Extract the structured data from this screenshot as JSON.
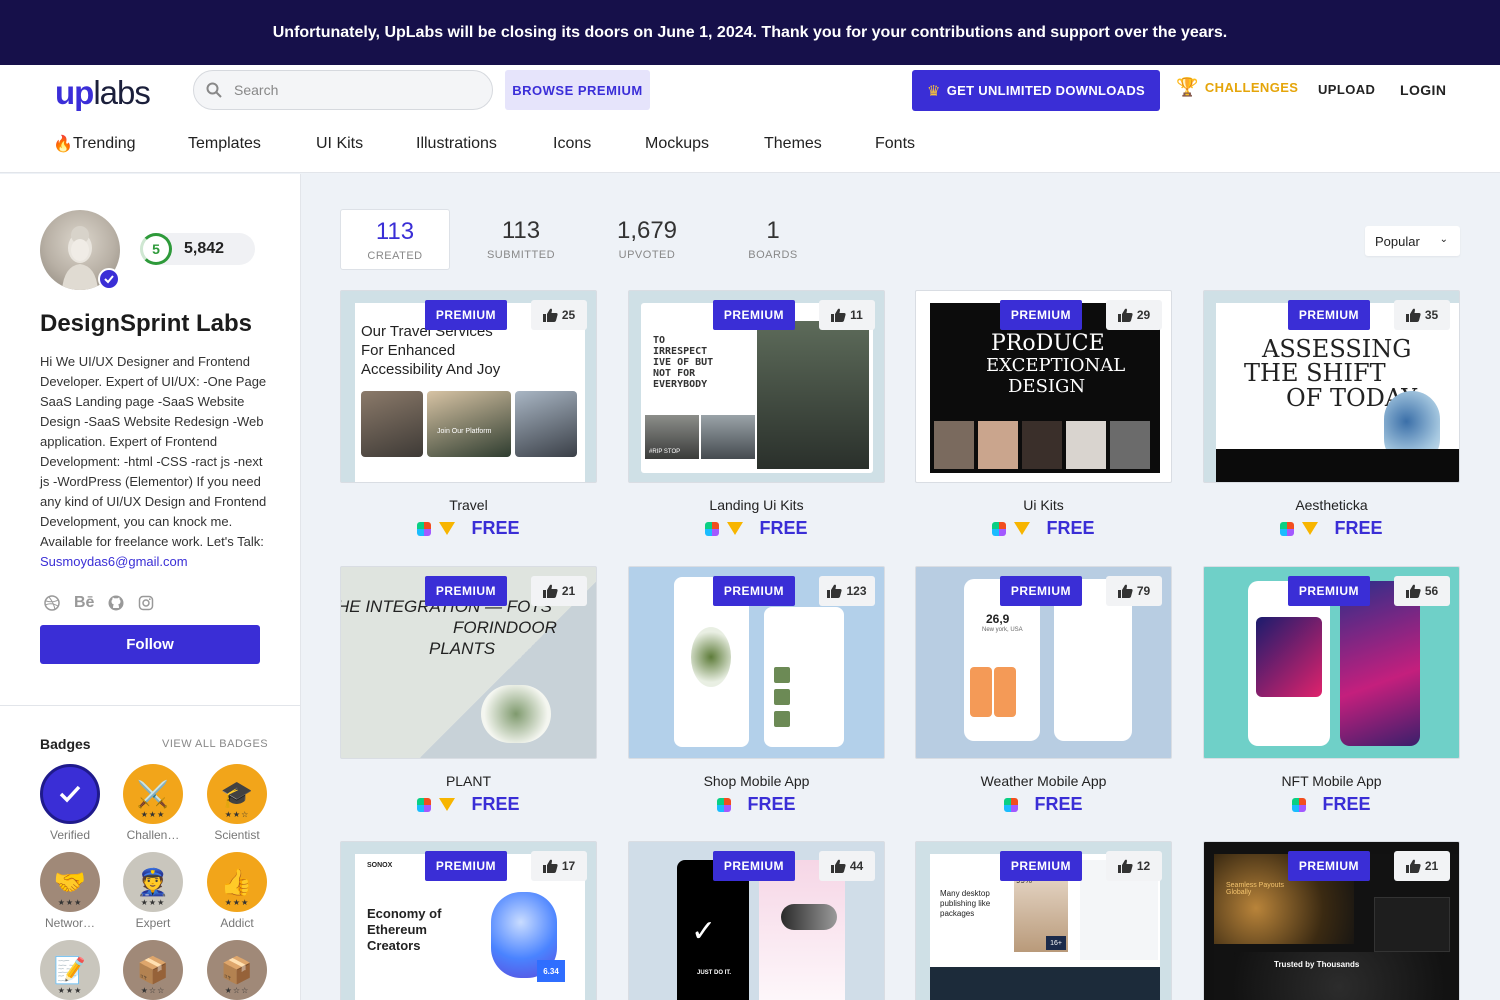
{
  "banner": {
    "text": "Unfortunately, UpLabs will be closing its doors on June 1, 2024. Thank you for your contributions and support over the years."
  },
  "header": {
    "logo_up": "up",
    "logo_labs": "labs",
    "search_placeholder": "Search",
    "browse_premium": "BROWSE PREMIUM",
    "get_unlimited": "GET UNLIMITED DOWNLOADS",
    "challenges": "CHALLENGES",
    "upload": "UPLOAD",
    "login": "LOGIN"
  },
  "nav": [
    "Trending",
    "Templates",
    "UI Kits",
    "Illustrations",
    "Icons",
    "Mockups",
    "Themes",
    "Fonts"
  ],
  "profile": {
    "level": "5",
    "points": "5,842",
    "name": "DesignSprint Labs",
    "bio": "Hi We UI/UX Designer and Frontend Developer. Expert of UI/UX: -One Page SaaS Landing page -SaaS Website Design -SaaS Website Redesign -Web application. Expert of Frontend Development: -html -CSS -ract js -next js -WordPress (Elementor) If you need any kind of UI/UX Design and Frontend Development, you can knock me. Available for freelance work. Let's Talk:",
    "email": "Susmoydas6@gmail.com",
    "follow": "Follow",
    "socials": [
      "dribbble-icon",
      "behance-icon",
      "github-icon",
      "instagram-icon"
    ],
    "behance_text": "Bē"
  },
  "badges": {
    "title": "Badges",
    "view_all": "VIEW ALL BADGES",
    "items": [
      {
        "label": "Verified",
        "icon": "check-icon",
        "color": "#3a2ed6"
      },
      {
        "label": "Challen…",
        "icon": "swords-icon",
        "color": "#f2a51a"
      },
      {
        "label": "Scientist",
        "icon": "graduation-cap-icon",
        "color": "#f2a51a"
      },
      {
        "label": "Networ…",
        "icon": "handshake-icon",
        "color": "#a08978"
      },
      {
        "label": "Expert",
        "icon": "officer-icon",
        "color": "#c9c6bd"
      },
      {
        "label": "Addict",
        "icon": "thumbs-up-icon",
        "color": "#f2a51a"
      },
      {
        "label": "",
        "icon": "notepad-icon",
        "color": "#c9c6bd"
      },
      {
        "label": "",
        "icon": "box-icon",
        "color": "#a08978"
      },
      {
        "label": "",
        "icon": "box-icon",
        "color": "#a08978"
      }
    ]
  },
  "stats": [
    {
      "value": "113",
      "label": "CREATED"
    },
    {
      "value": "113",
      "label": "SUBMITTED"
    },
    {
      "value": "1,679",
      "label": "UPVOTED"
    },
    {
      "value": "1",
      "label": "BOARDS"
    }
  ],
  "sort": {
    "selected": "Popular"
  },
  "premium_label": "PREMIUM",
  "free_label": "FREE",
  "cards": [
    {
      "title": "Travel",
      "likes": "25",
      "sketch": true,
      "bg": "#cfe0e6",
      "thumb_lines": [
        "Our Travel Services",
        "For Enhanced",
        "Accessibility And Joy"
      ],
      "thumb_caption": "Join Our Platform"
    },
    {
      "title": "Landing Ui Kits",
      "likes": "11",
      "sketch": true,
      "bg": "#cfe0e6",
      "thumb_lines": [
        "TO",
        "IRRESPECT",
        "IVE OF BUT",
        "NOT FOR",
        "EVERYBODY"
      ],
      "thumb_caption": "#RIP STOP"
    },
    {
      "title": "Ui Kits",
      "likes": "29",
      "sketch": true,
      "bg": "#ffffff",
      "thumb_lines": [
        "PRoDUCE",
        "EXCEPTIONAL",
        "DESIGN"
      ],
      "thumb_caption": ""
    },
    {
      "title": "Aestheticka",
      "likes": "35",
      "sketch": true,
      "bg": "#cfe0e6",
      "thumb_lines": [
        "ASSESSING",
        "THE SHIFT",
        "OF TODAY"
      ],
      "thumb_caption": ""
    },
    {
      "title": "PLANT",
      "likes": "21",
      "sketch": true,
      "bg": "#cfe0e6",
      "thumb_lines": [
        "HE INTEGRATION — FOTS",
        "FORINDOOR",
        "PLANTS"
      ],
      "thumb_caption": ""
    },
    {
      "title": "Shop Mobile App",
      "likes": "123",
      "sketch": false,
      "bg": "#b3d0ea",
      "thumb_lines": [],
      "thumb_caption": ""
    },
    {
      "title": "Weather Mobile App",
      "likes": "79",
      "sketch": false,
      "bg": "#b8cde2",
      "thumb_lines": [
        "26,9",
        "New york, USA"
      ],
      "thumb_caption": ""
    },
    {
      "title": "NFT Mobile App",
      "likes": "56",
      "sketch": false,
      "bg": "#6fd0c8",
      "thumb_lines": [],
      "thumb_caption": ""
    },
    {
      "title": "",
      "likes": "17",
      "sketch": false,
      "bg": "#cfe0e6",
      "thumb_lines": [
        "SONOX",
        "Economy of",
        "Ethereum",
        "Creators",
        "6.34"
      ],
      "thumb_caption": ""
    },
    {
      "title": "",
      "likes": "44",
      "sketch": false,
      "bg": "#d0dde8",
      "thumb_lines": [
        "JUST DO IT."
      ],
      "thumb_caption": ""
    },
    {
      "title": "",
      "likes": "12",
      "sketch": false,
      "bg": "#cfe0e6",
      "thumb_lines": [
        "Many desktop",
        "publishing like",
        "packages",
        "99%",
        "16+"
      ],
      "thumb_caption": ""
    },
    {
      "title": "",
      "likes": "21",
      "sketch": false,
      "bg": "#111111",
      "thumb_lines": [
        "Seamless Payouts Globally",
        "Trusted by Thousands"
      ],
      "thumb_caption": ""
    }
  ]
}
